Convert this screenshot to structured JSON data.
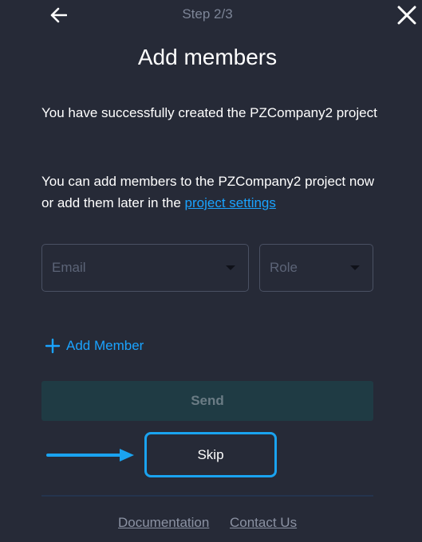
{
  "header": {
    "step": "Step 2/3",
    "title": "Add members"
  },
  "intro": {
    "success_text": "You have successfully created the PZCompany2 project",
    "add_text": "You can add members to the PZCompany2 project now or add them later in the ",
    "settings_link": "project settings"
  },
  "form": {
    "email_placeholder": "Email",
    "role_placeholder": "Role",
    "add_member_label": "Add Member",
    "send_label": "Send",
    "skip_label": "Skip"
  },
  "footer": {
    "documentation": "Documentation",
    "contact": "Contact Us"
  },
  "colors": {
    "background": "#262a37",
    "accent": "#1aa3ff",
    "send_button": "#1f3b44"
  },
  "icons": {
    "back": "arrow-left-icon",
    "close": "close-icon",
    "add": "plus-icon",
    "dropdown": "caret-down-icon",
    "annotation": "arrow-right-icon"
  }
}
